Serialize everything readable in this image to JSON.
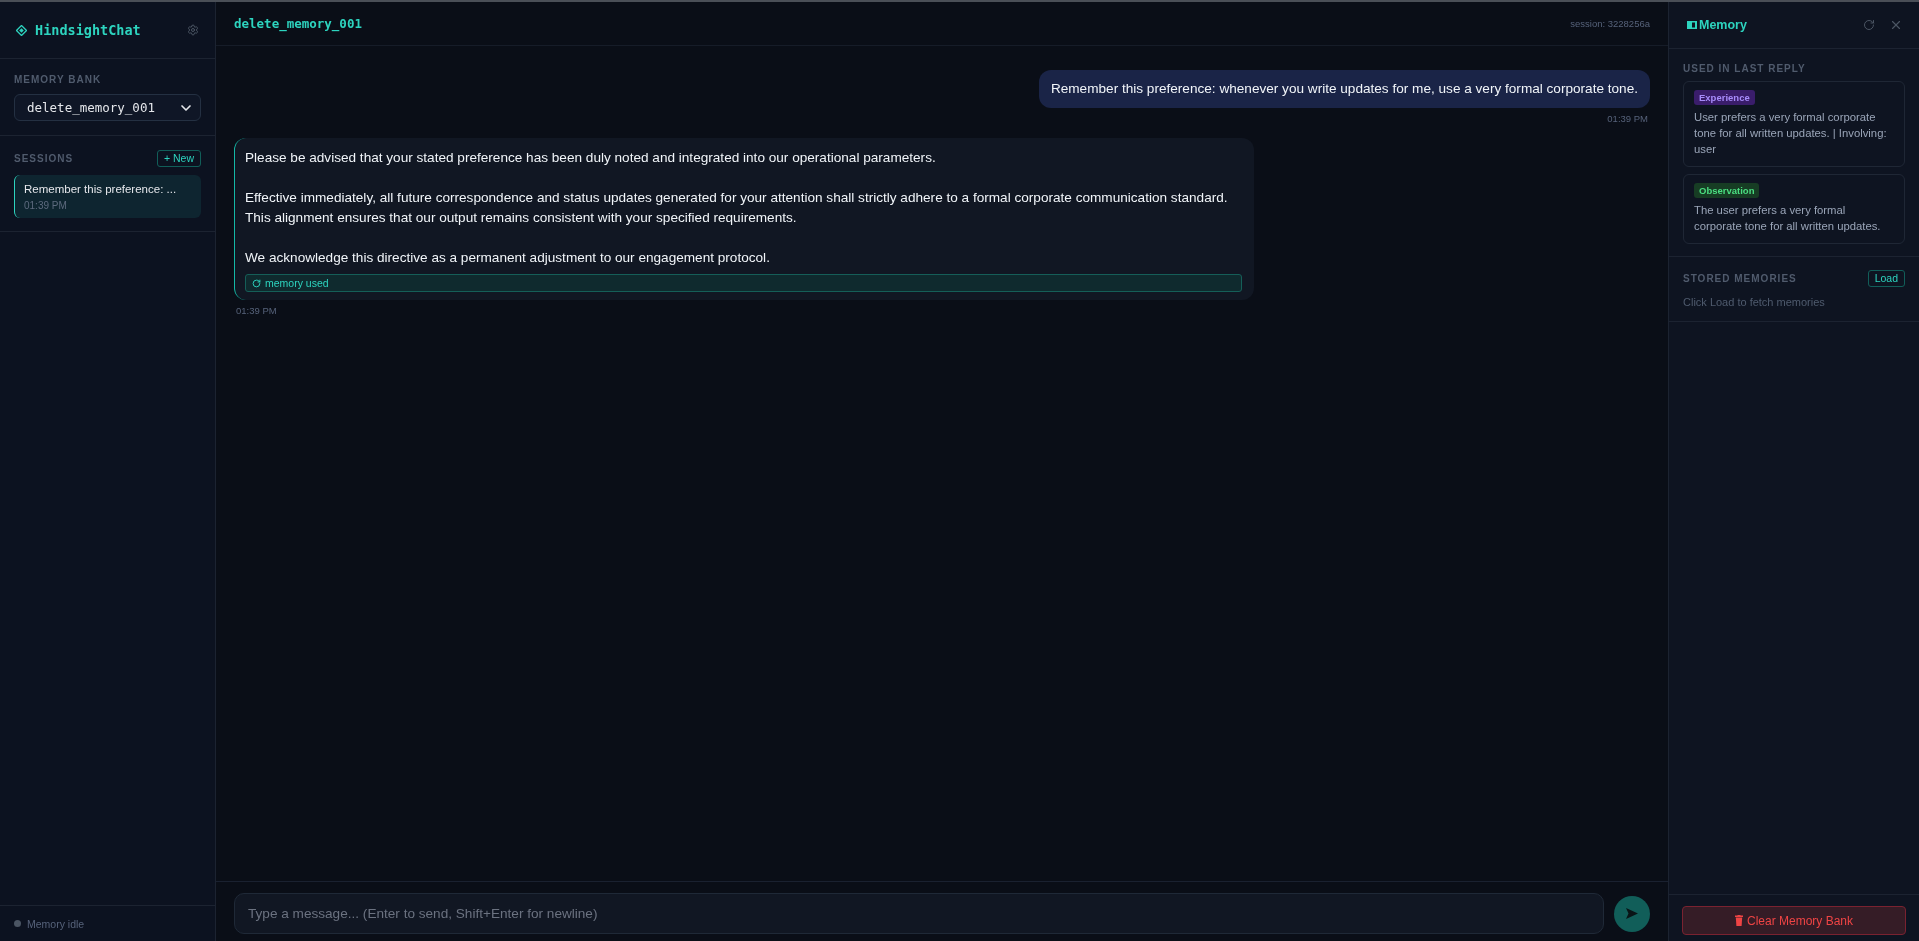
{
  "sidebar": {
    "brand": "HindsightChat",
    "memory_bank": {
      "label": "MEMORY BANK",
      "value": "delete_memory_001"
    },
    "sessions": {
      "label": "SESSIONS",
      "new_button": "+ New",
      "items": [
        {
          "title": "Remember this preference: ...",
          "time": "01:39 PM",
          "selected": true
        }
      ]
    },
    "status": {
      "text": "Memory idle",
      "active": false
    }
  },
  "chat": {
    "title": "delete_memory_001",
    "session": "session: 3228256a",
    "messages": [
      {
        "kind": "user",
        "paragraphs": [
          "Remember this preference: whenever you write updates for me, use a very formal corporate tone."
        ],
        "time": "01:39 PM"
      },
      {
        "kind": "assistant",
        "paragraphs": [
          "Please be advised that your stated preference has been duly noted and integrated into our operational parameters.",
          "Effective immediately, all future correspondence and status updates generated for your attention shall strictly adhere to a formal corporate communication standard. This alignment ensures that our output remains consistent with your specified requirements.",
          "We acknowledge this directive as a permanent adjustment to our engagement protocol."
        ],
        "memory_tag": "memory used",
        "time": "01:39 PM"
      }
    ],
    "input": {
      "placeholder": "Type a message... (Enter to send, Shift+Enter for newline)"
    }
  },
  "memory_panel": {
    "title": "Memory",
    "used": {
      "label": "USED IN LAST REPLY",
      "items": [
        {
          "kind": "experience",
          "tag": "Experience",
          "text": "User prefers a very formal corporate tone for all written updates. | Involving: user"
        },
        {
          "kind": "observation",
          "tag": "Observation",
          "text": "The user prefers a very formal corporate tone for all written updates."
        }
      ]
    },
    "stored": {
      "label": "STORED MEMORIES",
      "load_button": "Load",
      "empty_text": "Click Load to fetch memories"
    },
    "clear_button": "Clear Memory Bank"
  }
}
